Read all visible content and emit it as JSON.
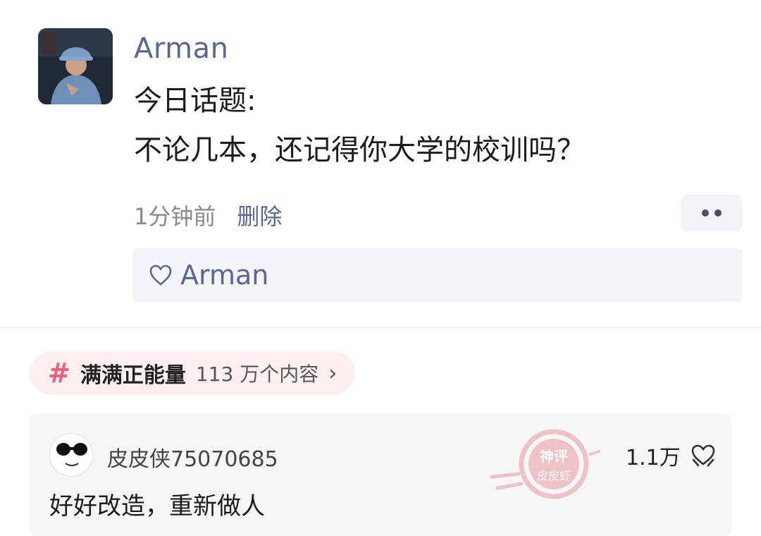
{
  "post": {
    "username": "Arman",
    "line1": "今日话题:",
    "line2": "不论几本，还记得你大学的校训吗？",
    "time": "1分钟前",
    "delete_label": "删除",
    "liker": "Arman"
  },
  "topic": {
    "hash": "#",
    "name": "满满正能量",
    "count": "113 万个内容",
    "chevron": "›"
  },
  "comment": {
    "username": "皮皮侠75070685",
    "text": "好好改造，重新做人",
    "likes": "1.1万"
  },
  "watermark": {
    "line1": "神评",
    "line2": "皮皮虾"
  },
  "colors": {
    "link": "#5b6792",
    "topic_accent": "#f0607a",
    "stamp": "#d9434f"
  },
  "icons": {
    "more": "ellipsis-icon",
    "like": "heart-outline-icon",
    "comment_like": "heart-hands-icon",
    "topic": "hashtag-icon"
  }
}
